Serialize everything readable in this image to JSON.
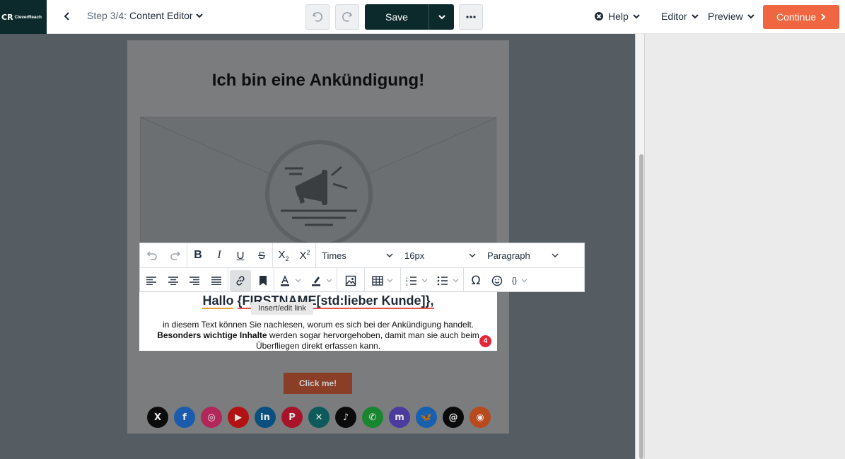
{
  "header": {
    "logo_text": "CleverReach",
    "step_prefix": "Step 3/4:",
    "step_title": "Content Editor",
    "save_label": "Save",
    "help_label": "Help",
    "editor_label": "Editor",
    "preview_label": "Preview",
    "continue_label": "Continue"
  },
  "email": {
    "heading": "Ich bin eine Ankündigung!",
    "greeting_part1": "Hallo",
    "greeting_part2": "{FIRSTNAME[std:lieber Kunde]},",
    "body_line1": "in diesem Text können Sie nachlesen, worum es sich bei der Ankündigung handelt.",
    "body_bold": "Besonders wichtige Inhalte",
    "body_line2_rest": " werden sogar hervorgehoben, damit man sie auch beim",
    "body_line3": "Überfliegen direkt erfassen kann.",
    "cta_label": "Click me!"
  },
  "toolbar": {
    "font_family": "Times",
    "font_size": "16px",
    "block_format": "Paragraph",
    "tooltip": "Insert/edit link",
    "badge_count": "4"
  },
  "socials": [
    {
      "name": "x",
      "glyph": "X",
      "color": "#0b0b0b"
    },
    {
      "name": "facebook",
      "glyph": "f",
      "color": "#1a5cab"
    },
    {
      "name": "instagram",
      "glyph": "◎",
      "color": "#b3265c"
    },
    {
      "name": "youtube",
      "glyph": "▶",
      "color": "#b31212"
    },
    {
      "name": "linkedin",
      "glyph": "in",
      "color": "#0a4f7e"
    },
    {
      "name": "pinterest",
      "glyph": "P",
      "color": "#a8132a"
    },
    {
      "name": "xing",
      "glyph": "✕",
      "color": "#0c5a5c"
    },
    {
      "name": "tiktok",
      "glyph": "♪",
      "color": "#0b0b0b"
    },
    {
      "name": "whatsapp",
      "glyph": "✆",
      "color": "#18862f"
    },
    {
      "name": "mastodon",
      "glyph": "m",
      "color": "#4b3b9e"
    },
    {
      "name": "bluesky",
      "glyph": "🦋",
      "color": "#1760b0"
    },
    {
      "name": "threads",
      "glyph": "@",
      "color": "#0b0b0b"
    },
    {
      "name": "rss",
      "glyph": "◉",
      "color": "#b84a1e"
    }
  ]
}
